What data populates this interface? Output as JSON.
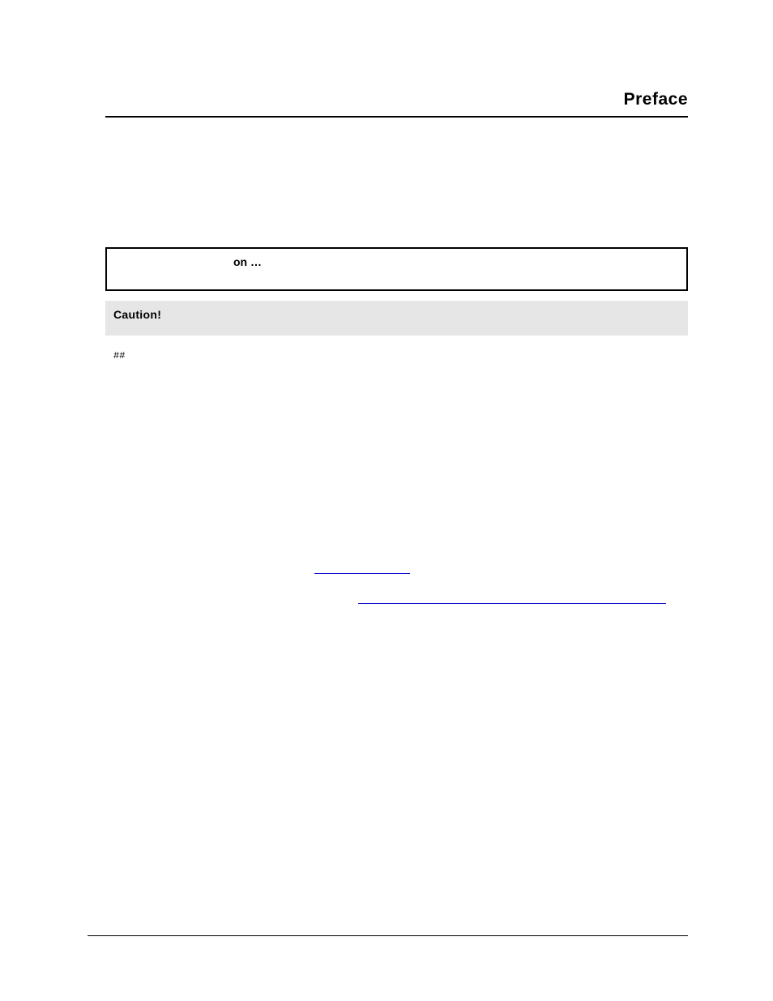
{
  "header": {
    "title": "Preface"
  },
  "infoBox": {
    "label": "on …"
  },
  "cautionBox": {
    "label": "Caution!"
  },
  "hash": "##",
  "links": {
    "first": " ",
    "second": " "
  }
}
